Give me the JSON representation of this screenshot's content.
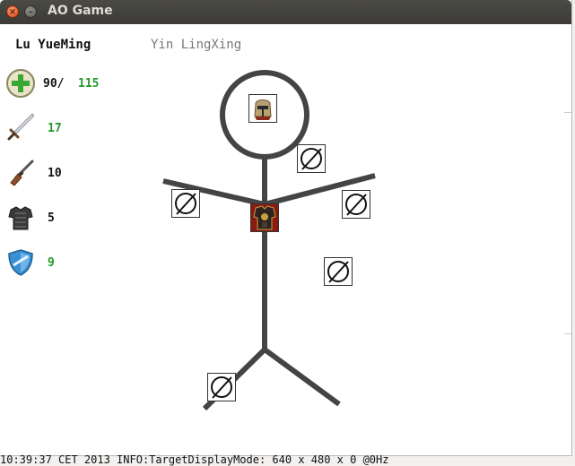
{
  "window": {
    "title": "AO Game"
  },
  "tabs": [
    {
      "label": "Lu YueMing",
      "active": true
    },
    {
      "label": "Yin LingXing",
      "active": false
    }
  ],
  "stats": {
    "health": {
      "current": "90/",
      "max": "115",
      "icon": "health-plus-icon"
    },
    "attack": {
      "value": "17",
      "icon": "sword-icon",
      "color": "#1f9a2a"
    },
    "ranged": {
      "value": "10",
      "icon": "musket-icon",
      "color": "#111111"
    },
    "armor": {
      "value": "5",
      "icon": "armor-icon",
      "color": "#111111"
    },
    "defense": {
      "value": "9",
      "icon": "shield-icon",
      "color": "#1f9a2a"
    }
  },
  "equipment": {
    "head": {
      "state": "equipped",
      "icon": "knight-helmet-icon"
    },
    "neck": {
      "state": "empty",
      "icon": "empty-slot-icon"
    },
    "left_hand": {
      "state": "empty",
      "icon": "empty-slot-icon"
    },
    "right_hand": {
      "state": "empty",
      "icon": "empty-slot-icon"
    },
    "body": {
      "state": "equipped",
      "icon": "dark-armor-icon"
    },
    "belt": {
      "state": "empty",
      "icon": "empty-slot-icon"
    },
    "foot": {
      "state": "empty",
      "icon": "empty-slot-icon"
    }
  },
  "console": {
    "text": "10:39:37 CET 2013 INFO:TargetDisplayMode: 640 x 480 x 0 @0Hz"
  },
  "colors": {
    "accent_green": "#1f9a2a",
    "figure": "#444444",
    "titlebar": "#3c3b37"
  }
}
